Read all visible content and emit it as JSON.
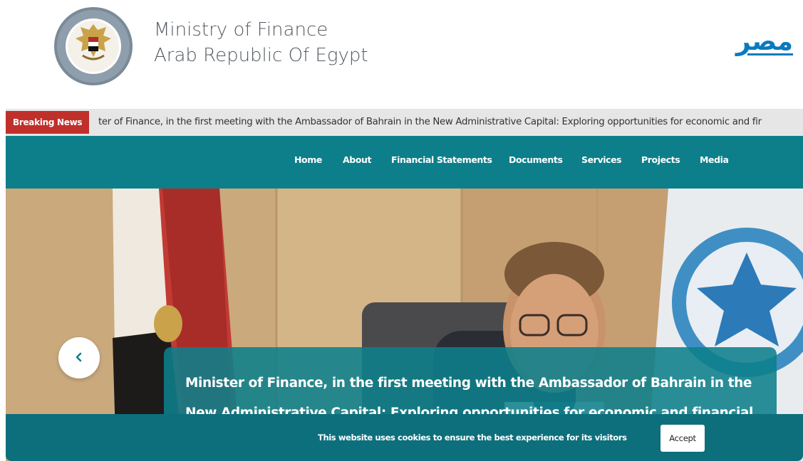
{
  "header": {
    "title_line1": "Ministry of Finance",
    "title_line2": "Arab Republic Of Egypt",
    "language_link": "مصر"
  },
  "ticker": {
    "label": "Breaking News",
    "text": "ter of Finance, in the first meeting with the Ambassador of Bahrain in the New Administrative Capital: Exploring opportunities for economic and fir"
  },
  "nav": {
    "items": [
      "Home",
      "About",
      "Financial Statements",
      "Documents",
      "Services",
      "Projects",
      "Media"
    ]
  },
  "slider": {
    "caption": "Minister of Finance, in the first meeting with the Ambassador of Bahrain in the New Administrative Capital: Exploring opportunities for economic and financial",
    "prev_icon": "chevron-left-icon"
  },
  "cookie": {
    "message": "This website uses cookies to ensure the best experience for its visitors",
    "accept_label": "Accept"
  },
  "colors": {
    "teal": "#0d7f8b",
    "red": "#c0302b",
    "link_blue": "#0a7abf"
  }
}
